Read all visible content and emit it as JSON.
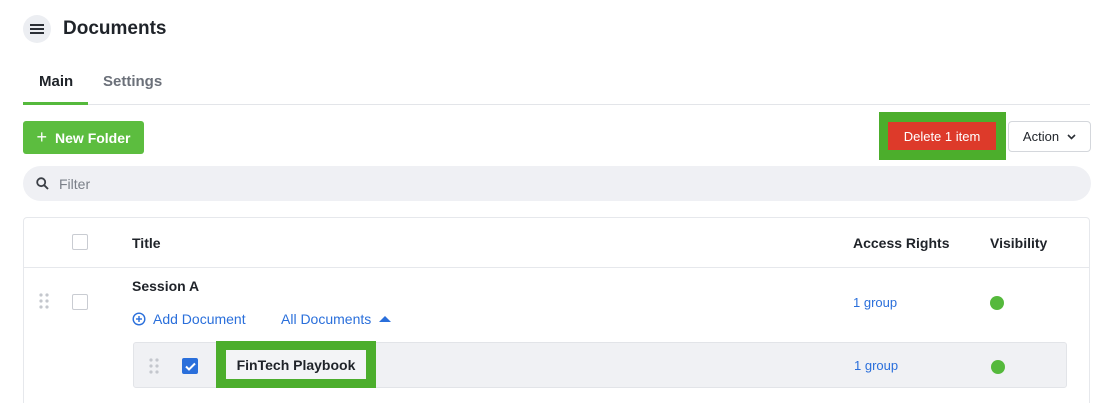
{
  "header": {
    "title": "Documents",
    "menu_icon": "hamburger-menu-icon"
  },
  "tabs": [
    {
      "label": "Main",
      "active": true
    },
    {
      "label": "Settings",
      "active": false
    }
  ],
  "toolbar": {
    "new_folder_label": "New Folder",
    "delete_label": "Delete 1 item",
    "action_label": "Action"
  },
  "filter": {
    "placeholder": "Filter",
    "value": ""
  },
  "table": {
    "columns": {
      "title": "Title",
      "access": "Access Rights",
      "visibility": "Visibility"
    },
    "session": {
      "title": "Session A",
      "add_document": "Add Document",
      "all_documents": "All Documents",
      "access": "1 group",
      "visible": true
    },
    "document": {
      "title": "FinTech Playbook",
      "checked": true,
      "access": "1 group",
      "visible": true
    }
  },
  "colors": {
    "accent_green": "#5cbd3f",
    "highlight_green": "#4cae2c",
    "danger_red": "#dd3a2a",
    "link_blue": "#2a6fdb"
  }
}
